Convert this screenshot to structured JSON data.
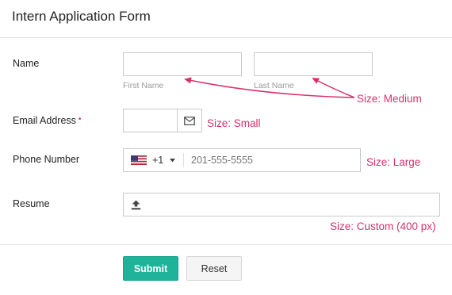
{
  "form": {
    "title": "Intern Application Form",
    "name": {
      "label": "Name",
      "first_sublabel": "First Name",
      "last_sublabel": "Last Name",
      "first_value": "",
      "last_value": ""
    },
    "email": {
      "label": "Email Address",
      "required_marker": "•",
      "value": ""
    },
    "phone": {
      "label": "Phone Number",
      "country_code": "+1",
      "placeholder": "201-555-5555"
    },
    "resume": {
      "label": "Resume"
    },
    "buttons": {
      "submit": "Submit",
      "reset": "Reset"
    }
  },
  "annotations": {
    "medium": "Size: Medium",
    "small": "Size: Small",
    "large": "Size: Large",
    "custom": "Size: Custom (400 px)"
  },
  "colors": {
    "accent": "#1fb39a",
    "annotation": "#d9306b",
    "required": "#d9304f"
  },
  "icons": {
    "email_addon": "envelope-icon",
    "phone_flag": "us-flag-icon",
    "phone_dropdown": "caret-down-icon",
    "resume_upload": "upload-icon"
  }
}
